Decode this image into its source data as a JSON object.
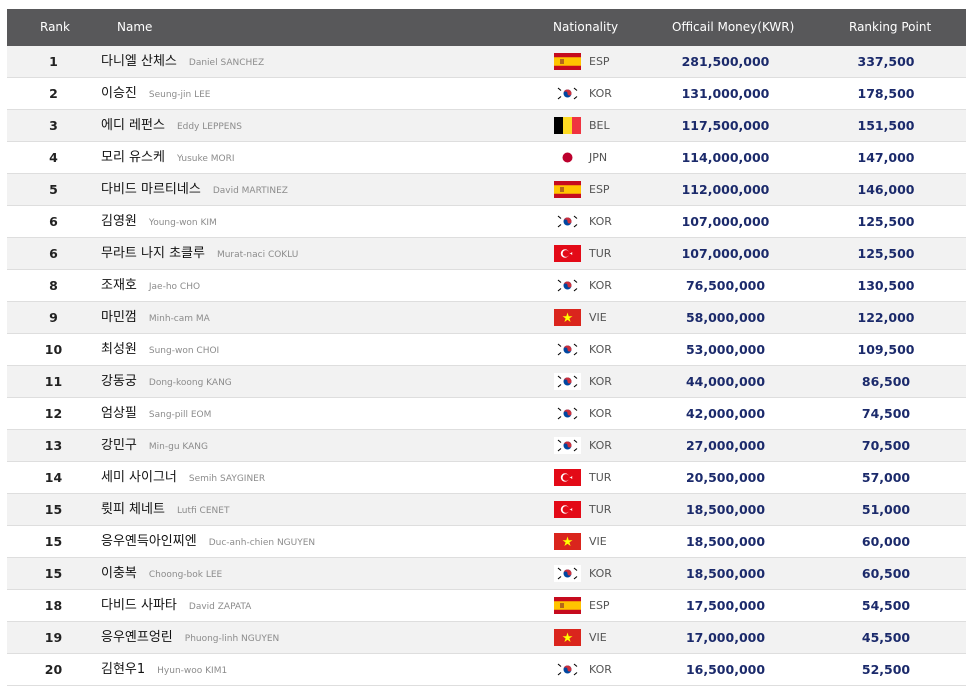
{
  "header": {
    "rank": "Rank",
    "name": "Name",
    "nationality": "Nationality",
    "money": "Officail Money(KWR)",
    "points": "Ranking Point"
  },
  "colors": {
    "header_bg": "#58585a",
    "value_text": "#1b2a6b"
  },
  "rows": [
    {
      "rank": "1",
      "name_ko": "다니엘 산체스",
      "name_en": "Daniel SANCHEZ",
      "flag": "esp-flag",
      "nat": "ESP",
      "money": "281,500,000",
      "points": "337,500"
    },
    {
      "rank": "2",
      "name_ko": "이승진",
      "name_en": "Seung-jin LEE",
      "flag": "kor-flag",
      "nat": "KOR",
      "money": "131,000,000",
      "points": "178,500"
    },
    {
      "rank": "3",
      "name_ko": "에디 레펀스",
      "name_en": "Eddy LEPPENS",
      "flag": "bel-flag",
      "nat": "BEL",
      "money": "117,500,000",
      "points": "151,500"
    },
    {
      "rank": "4",
      "name_ko": "모리 유스케",
      "name_en": "Yusuke MORI",
      "flag": "jpn-flag",
      "nat": "JPN",
      "money": "114,000,000",
      "points": "147,000"
    },
    {
      "rank": "5",
      "name_ko": "다비드 마르티네스",
      "name_en": "David MARTINEZ",
      "flag": "esp-flag",
      "nat": "ESP",
      "money": "112,000,000",
      "points": "146,000"
    },
    {
      "rank": "6",
      "name_ko": "김영원",
      "name_en": "Young-won KIM",
      "flag": "kor-flag",
      "nat": "KOR",
      "money": "107,000,000",
      "points": "125,500"
    },
    {
      "rank": "6",
      "name_ko": "무라트 나지 초클루",
      "name_en": "Murat-naci COKLU",
      "flag": "tur-flag",
      "nat": "TUR",
      "money": "107,000,000",
      "points": "125,500"
    },
    {
      "rank": "8",
      "name_ko": "조재호",
      "name_en": "Jae-ho CHO",
      "flag": "kor-flag",
      "nat": "KOR",
      "money": "76,500,000",
      "points": "130,500"
    },
    {
      "rank": "9",
      "name_ko": "마민껌",
      "name_en": "Minh-cam MA",
      "flag": "vie-flag",
      "nat": "VIE",
      "money": "58,000,000",
      "points": "122,000"
    },
    {
      "rank": "10",
      "name_ko": "최성원",
      "name_en": "Sung-won CHOI",
      "flag": "kor-flag",
      "nat": "KOR",
      "money": "53,000,000",
      "points": "109,500"
    },
    {
      "rank": "11",
      "name_ko": "강동궁",
      "name_en": "Dong-koong KANG",
      "flag": "kor-flag",
      "nat": "KOR",
      "money": "44,000,000",
      "points": "86,500"
    },
    {
      "rank": "12",
      "name_ko": "엄상필",
      "name_en": "Sang-pill EOM",
      "flag": "kor-flag",
      "nat": "KOR",
      "money": "42,000,000",
      "points": "74,500"
    },
    {
      "rank": "13",
      "name_ko": "강민구",
      "name_en": "Min-gu KANG",
      "flag": "kor-flag",
      "nat": "KOR",
      "money": "27,000,000",
      "points": "70,500"
    },
    {
      "rank": "14",
      "name_ko": "세미 사이그너",
      "name_en": "Semih SAYGINER",
      "flag": "tur-flag",
      "nat": "TUR",
      "money": "20,500,000",
      "points": "57,000"
    },
    {
      "rank": "15",
      "name_ko": "륏피 체네트",
      "name_en": "Lutfi CENET",
      "flag": "tur-flag",
      "nat": "TUR",
      "money": "18,500,000",
      "points": "51,000"
    },
    {
      "rank": "15",
      "name_ko": "응우옌득아인찌엔",
      "name_en": "Duc-anh-chien NGUYEN",
      "flag": "vie-flag",
      "nat": "VIE",
      "money": "18,500,000",
      "points": "60,000"
    },
    {
      "rank": "15",
      "name_ko": "이충복",
      "name_en": "Choong-bok LEE",
      "flag": "kor-flag",
      "nat": "KOR",
      "money": "18,500,000",
      "points": "60,500"
    },
    {
      "rank": "18",
      "name_ko": "다비드 사파타",
      "name_en": "David ZAPATA",
      "flag": "esp-flag",
      "nat": "ESP",
      "money": "17,500,000",
      "points": "54,500"
    },
    {
      "rank": "19",
      "name_ko": "응우옌프엉린",
      "name_en": "Phuong-linh NGUYEN",
      "flag": "vie-flag",
      "nat": "VIE",
      "money": "17,000,000",
      "points": "45,500"
    },
    {
      "rank": "20",
      "name_ko": "김현우1",
      "name_en": "Hyun-woo KIM1",
      "flag": "kor-flag",
      "nat": "KOR",
      "money": "16,500,000",
      "points": "52,500"
    }
  ]
}
